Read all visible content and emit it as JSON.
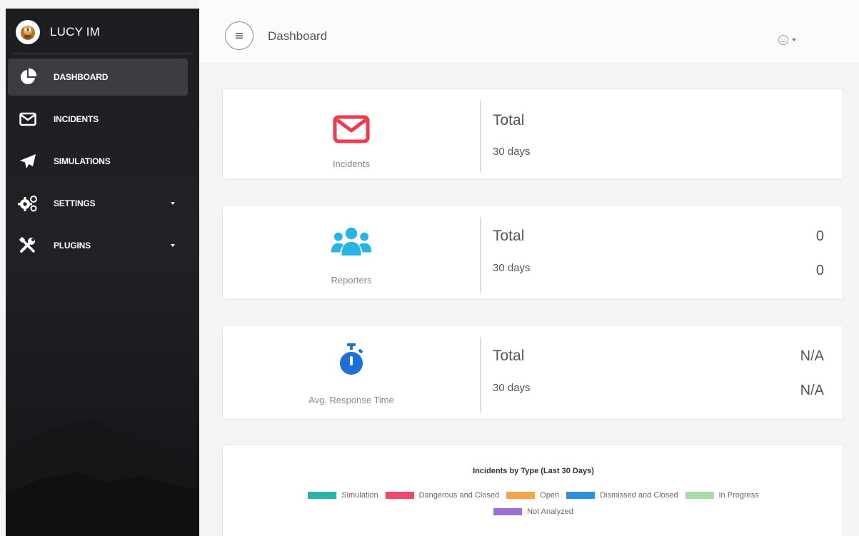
{
  "app": {
    "brand": "LUCY IM"
  },
  "sidebar": {
    "items": [
      {
        "label": "DASHBOARD",
        "icon": "pie-chart-icon",
        "active": true
      },
      {
        "label": "INCIDENTS",
        "icon": "envelope-icon"
      },
      {
        "label": "SIMULATIONS",
        "icon": "paper-plane-icon"
      },
      {
        "label": "SETTINGS",
        "icon": "gears-icon",
        "has_submenu": true
      },
      {
        "label": "PLUGINS",
        "icon": "tools-icon",
        "has_submenu": true
      }
    ]
  },
  "header": {
    "title": "Dashboard",
    "menu_icon": "hamburger-icon",
    "user_icon": "smiley-icon"
  },
  "cards": [
    {
      "caption": "Incidents",
      "icon": "envelope-icon",
      "icon_color": "#ee3a4f",
      "total_label": "Total",
      "total_value": "",
      "period_label": "30 days",
      "period_value": ""
    },
    {
      "caption": "Reporters",
      "icon": "users-icon",
      "icon_color": "#27b3e4",
      "total_label": "Total",
      "total_value": "0",
      "period_label": "30 days",
      "period_value": "0"
    },
    {
      "caption": "Avg. Response Time",
      "icon": "stopwatch-icon",
      "icon_color": "#1e6fd8",
      "total_label": "Total",
      "total_value": "N/A",
      "period_label": "30 days",
      "period_value": "N/A"
    }
  ],
  "chart": {
    "title": "Incidents by Type (Last 30 Days)",
    "legend": [
      {
        "label": "Simulation",
        "color": "#2ab3a8"
      },
      {
        "label": "Dangerous and Closed",
        "color": "#f4466b"
      },
      {
        "label": "Open",
        "color": "#f7a34b"
      },
      {
        "label": "Dismissed and Closed",
        "color": "#2d8fe0"
      },
      {
        "label": "In Progress",
        "color": "#a7dca8"
      },
      {
        "label": "Not Analyzed",
        "color": "#9a6fd6"
      }
    ]
  }
}
